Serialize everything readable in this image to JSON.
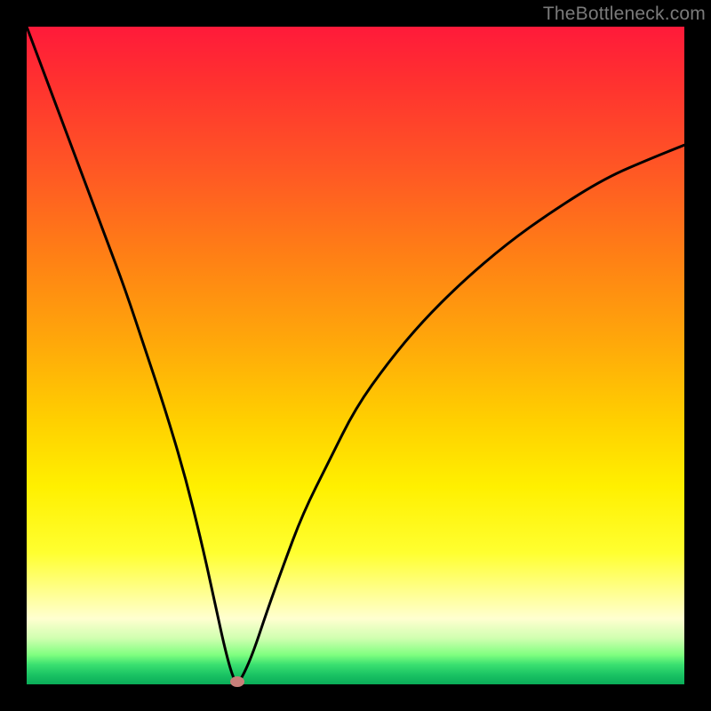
{
  "watermark": "TheBottleneck.com",
  "chart_data": {
    "type": "line",
    "title": "",
    "xlabel": "",
    "ylabel": "",
    "xlim": [
      0,
      100
    ],
    "ylim": [
      0,
      100
    ],
    "grid": false,
    "legend": false,
    "background_gradient": {
      "direction": "vertical",
      "stops": [
        {
          "pos": 0,
          "label": "severe",
          "color": "#ff1a3a"
        },
        {
          "pos": 50,
          "label": "moderate",
          "color": "#ffd000"
        },
        {
          "pos": 100,
          "label": "none",
          "color": "#0aac58"
        }
      ]
    },
    "series": [
      {
        "name": "bottleneck-curve",
        "color": "#000000",
        "x": [
          0,
          3,
          6,
          9,
          12,
          15,
          18,
          21,
          24,
          26.5,
          28.5,
          30,
          31.2,
          32,
          33,
          34.5,
          36.5,
          39,
          42,
          46,
          50,
          55,
          60,
          66,
          73,
          80,
          88,
          95,
          100
        ],
        "y_pct": [
          100,
          92,
          84,
          76,
          68,
          60,
          51,
          42,
          32,
          22,
          13,
          6,
          1.5,
          0,
          1.5,
          5,
          11,
          18,
          26,
          34,
          42,
          49,
          55,
          61,
          67,
          72,
          77,
          80,
          82
        ]
      }
    ],
    "marker": {
      "x": 32,
      "y_pct": 0,
      "label": "optimal-point",
      "color": "#c97f7a"
    }
  }
}
